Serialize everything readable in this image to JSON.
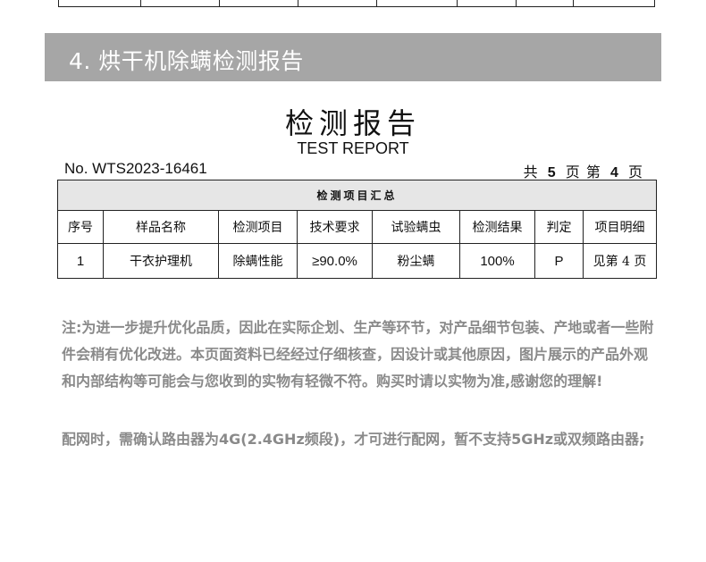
{
  "section": {
    "title": "4. 烘干机除螨检测报告"
  },
  "report": {
    "title": "检测报告",
    "subtitle": "TEST REPORT",
    "number": "No. WTS2023-16461",
    "page": {
      "total_prefix": "共",
      "total": "5",
      "total_suffix": "页",
      "current_prefix": "第",
      "current": "4",
      "current_suffix": "页"
    }
  },
  "summary_table": {
    "caption": "检测项目汇总",
    "headers": [
      "序号",
      "样品名称",
      "检测项目",
      "技术要求",
      "试验螨虫",
      "检测结果",
      "判定",
      "项目明细"
    ],
    "rows": [
      [
        "1",
        "干衣护理机",
        "除螨性能",
        "≥90.0%",
        "粉尘螨",
        "100%",
        "P",
        "见第 4 页"
      ]
    ]
  },
  "notes": [
    "注:为进一步提升优化品质，因此在实际企划、生产等环节，对产品细节包装、产地或者一些附件会稍有优化改进。本页面资料已经经过仔细核查，因设计或其他原因，图片展示的产品外观和内部结构等可能会与您收到的实物有轻微不符。购买时请以实物为准,感谢您的理解!",
    "配网时，需确认路由器为4G(2.4GHz频段)，才可进行配网，暂不支持5GHz或双频路由器;"
  ]
}
